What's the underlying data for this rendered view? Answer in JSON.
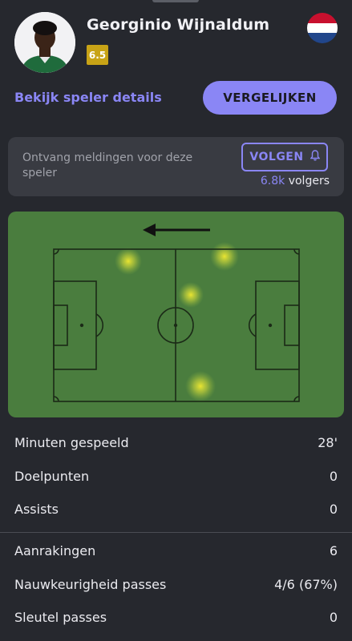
{
  "player": {
    "name": "Georginio Wijnaldum",
    "rating": "6.5",
    "country_flag": "netherlands-flag"
  },
  "actions": {
    "details_link": "Bekijk speler details",
    "compare_button": "VERGELIJKEN"
  },
  "notifications": {
    "text": "Ontvang meldingen voor deze speler",
    "follow_button": "VOLGEN",
    "followers_count": "6.8k",
    "followers_label": "volgers"
  },
  "heatmap": {
    "attack_direction": "left",
    "colors": {
      "pitch": "#4a7d3e",
      "lines": "#1b2a17",
      "heat": "#f2ea30"
    }
  },
  "stats_group_1": [
    {
      "label": "Minuten gespeeld",
      "value": "28'"
    },
    {
      "label": "Doelpunten",
      "value": "0"
    },
    {
      "label": "Assists",
      "value": "0"
    }
  ],
  "stats_group_2": [
    {
      "label": "Aanrakingen",
      "value": "6"
    },
    {
      "label": "Nauwkeurigheid passes",
      "value": "4/6 (67%)"
    },
    {
      "label": "Sleutel passes",
      "value": "0"
    }
  ],
  "colors": {
    "background": "#26282e",
    "accent": "#8a86f5",
    "rating_badge": "#c8a316",
    "card": "#393b42"
  }
}
